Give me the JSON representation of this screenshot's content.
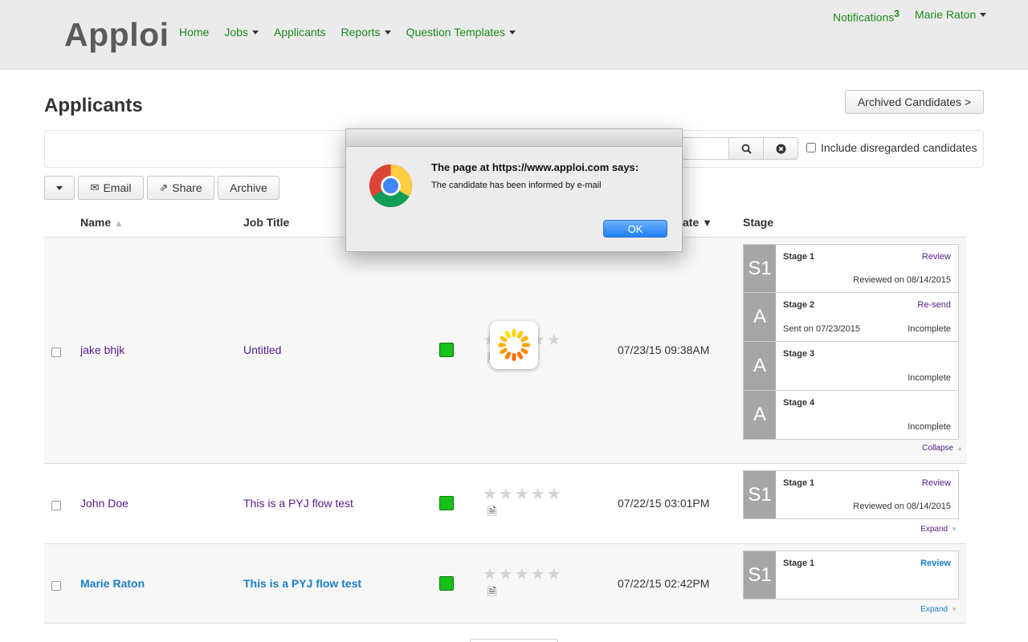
{
  "header": {
    "logo": "Apploi",
    "nav": [
      {
        "label": "Home",
        "dropdown": false
      },
      {
        "label": "Jobs",
        "dropdown": true
      },
      {
        "label": "Applicants",
        "dropdown": false
      },
      {
        "label": "Reports",
        "dropdown": true
      },
      {
        "label": "Question Templates",
        "dropdown": true
      }
    ],
    "notifications_label": "Notifications",
    "notifications_count": "3",
    "user_name": "Marie Raton"
  },
  "page": {
    "title": "Applicants",
    "archived_button": "Archived Candidates >"
  },
  "filter": {
    "include_disregarded_label": "Include disregarded candidates"
  },
  "toolbar": {
    "email_label": "Email",
    "share_label": "Share",
    "archive_label": "Archive"
  },
  "table": {
    "columns": {
      "name": "Name",
      "job_title": "Job Title",
      "date": "ate",
      "stage": "Stage"
    },
    "rows": [
      {
        "name": "jake bhjk",
        "job_title": "Untitled",
        "date": "07/23/15 09:38AM",
        "rating": 0,
        "stages": [
          {
            "badge": "S1",
            "name": "Stage 1",
            "action": "Review",
            "left": "",
            "right": "Reviewed on 08/14/2015"
          },
          {
            "badge": "A",
            "name": "Stage 2",
            "action": "Re-send",
            "left": "Sent on 07/23/2015",
            "right": "Incomplete"
          },
          {
            "badge": "A",
            "name": "Stage 3",
            "action": "",
            "left": "",
            "right": "Incomplete"
          },
          {
            "badge": "A",
            "name": "Stage 4",
            "action": "",
            "left": "",
            "right": "Incomplete"
          }
        ],
        "toggle": "Collapse"
      },
      {
        "name": "John Doe",
        "job_title": "This is a PYJ flow test",
        "date": "07/22/15 03:01PM",
        "rating": 0,
        "stages": [
          {
            "badge": "S1",
            "name": "Stage 1",
            "action": "Review",
            "left": "",
            "right": "Reviewed on 08/14/2015"
          }
        ],
        "toggle": "Expand"
      },
      {
        "name": "Marie Raton",
        "job_title": "This is a PYJ flow test",
        "date": "07/22/15 02:42PM",
        "rating": 0,
        "stages": [
          {
            "badge": "S1",
            "name": "Stage 1",
            "action": "Review",
            "left": "",
            "right": ""
          }
        ],
        "toggle": "Expand"
      }
    ]
  },
  "dialog": {
    "title": "The page at https://www.apploi.com says:",
    "message": "The candidate has been informed by e-mail",
    "ok_label": "OK"
  },
  "colors": {
    "nav_green": "#1c8a1c",
    "status_green": "#17c117",
    "link_purple": "#551a8b",
    "link_blue": "#1a7fc9",
    "stage_badge_gray": "#a6a6a6"
  }
}
